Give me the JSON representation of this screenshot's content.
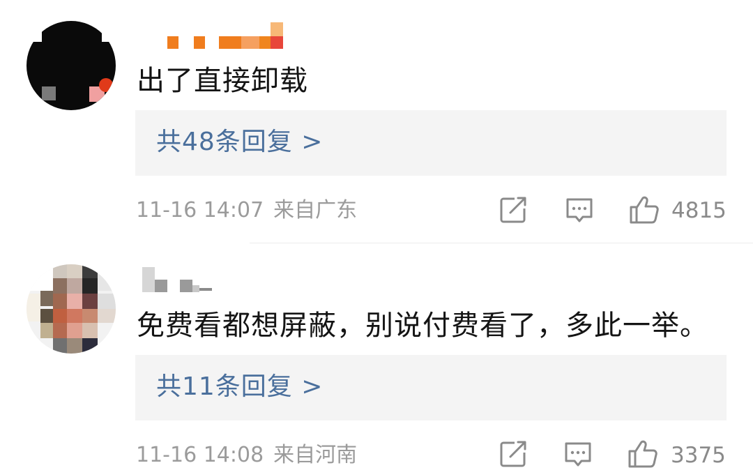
{
  "comments": [
    {
      "text": "出了直接卸载",
      "reply_link": "共48条回复 >",
      "date": "11-16 14:07",
      "location": "来自广东",
      "likes": "4815",
      "icons": [
        "share-icon",
        "comment-icon",
        "like-icon"
      ]
    },
    {
      "text": "免费看都想屏蔽，别说付费看了，多此一举。",
      "reply_link": "共11条回复 >",
      "date": "11-16 14:08",
      "location": "来自河南",
      "likes": "3375",
      "icons": [
        "share-icon",
        "comment-icon",
        "like-icon"
      ]
    }
  ],
  "colors": {
    "reply_link": "#4a6f9c",
    "meta": "#9b9b9b",
    "reply_box": "#f4f4f4"
  }
}
